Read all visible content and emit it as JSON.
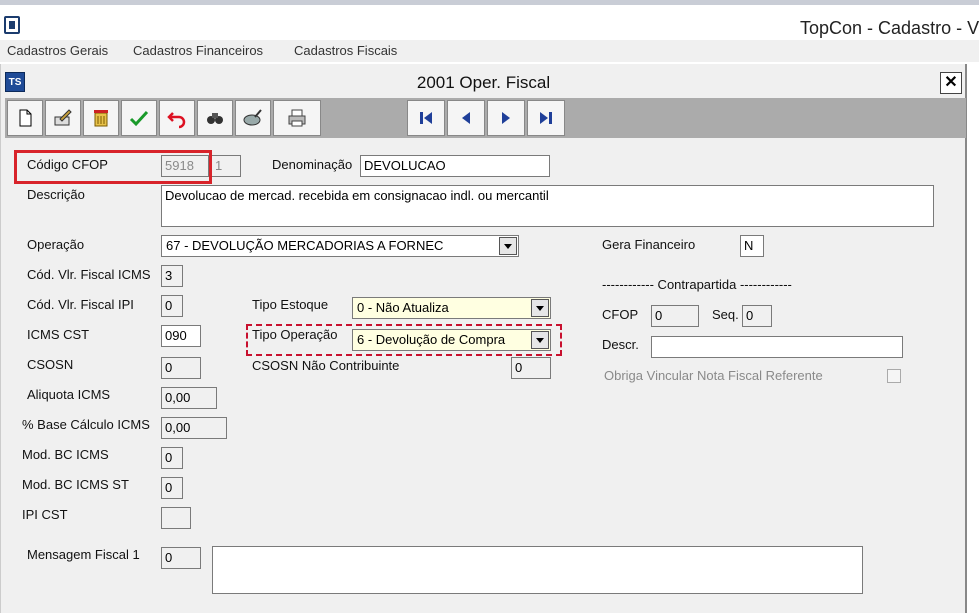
{
  "app": {
    "title": "TopCon - Cadastro - V"
  },
  "menu": [
    "Cadastros Gerais",
    "Cadastros Financeiros",
    "Cadastros Fiscais"
  ],
  "form": {
    "title": "2001 Oper. Fiscal",
    "icon_text": "TS",
    "close_label": "✕"
  },
  "toolbar": {
    "buttons": [
      "new-icon",
      "edit-icon",
      "delete-icon",
      "confirm-icon",
      "undo-icon",
      "search-icon",
      "lookup-icon",
      "print-icon",
      "first-record-icon",
      "previous-record-icon",
      "next-record-icon",
      "last-record-icon"
    ]
  },
  "fields": {
    "codigo_cfop": {
      "label": "Código CFOP",
      "value": "5918",
      "seq": "1"
    },
    "denominacao": {
      "label": "Denominação",
      "value": "DEVOLUCAO"
    },
    "descricao": {
      "label": "Descrição",
      "value": "Devolucao de mercad. recebida em consignacao indl. ou mercantil"
    },
    "operacao": {
      "label": "Operação",
      "value": "67 - DEVOLUÇÃO MERCADORIAS A FORNEC"
    },
    "gera_financeiro": {
      "label": "Gera Financeiro",
      "value": "N"
    },
    "cod_vlr_fiscal_icms": {
      "label": "Cód. Vlr. Fiscal ICMS",
      "value": "3"
    },
    "cod_vlr_fiscal_ipi": {
      "label": "Cód. Vlr. Fiscal IPI",
      "value": "0"
    },
    "tipo_estoque": {
      "label": "Tipo Estoque",
      "value": "0 - Não Atualiza"
    },
    "icms_cst": {
      "label": "ICMS CST",
      "value": "090"
    },
    "tipo_operacao": {
      "label": "Tipo Operação",
      "value": "6 - Devolução de Compra"
    },
    "csosn": {
      "label": "CSOSN",
      "value": "0"
    },
    "csosn_nao_contribuinte": {
      "label": "CSOSN Não Contribuinte",
      "value": "0"
    },
    "aliquota_icms": {
      "label": "Aliquota ICMS",
      "value": "0,00"
    },
    "base_calculo_icms": {
      "label": "% Base Cálculo ICMS",
      "value": "0,00"
    },
    "mod_bc_icms": {
      "label": "Mod. BC ICMS",
      "value": "0"
    },
    "mod_bc_icms_st": {
      "label": "Mod. BC ICMS ST",
      "value": "0"
    },
    "ipi_cst": {
      "label": "IPI CST",
      "value": ""
    },
    "mensagem_fiscal_1": {
      "label": "Mensagem Fiscal 1",
      "value": "0",
      "text": ""
    }
  },
  "contrapartida": {
    "heading": "------------  Contrapartida  ------------",
    "cfop_label": "CFOP",
    "cfop_value": "0",
    "seq_label": "Seq.",
    "seq_value": "0",
    "descr_label": "Descr.",
    "descr_value": "",
    "obriga_label": "Obriga Vincular Nota Fiscal Referente"
  },
  "colors": {
    "highlight_red": "#d8232a",
    "toolbar_bg": "#ababab",
    "form_bg": "#f0f0f0",
    "nav_blue": "#1f3f99"
  }
}
